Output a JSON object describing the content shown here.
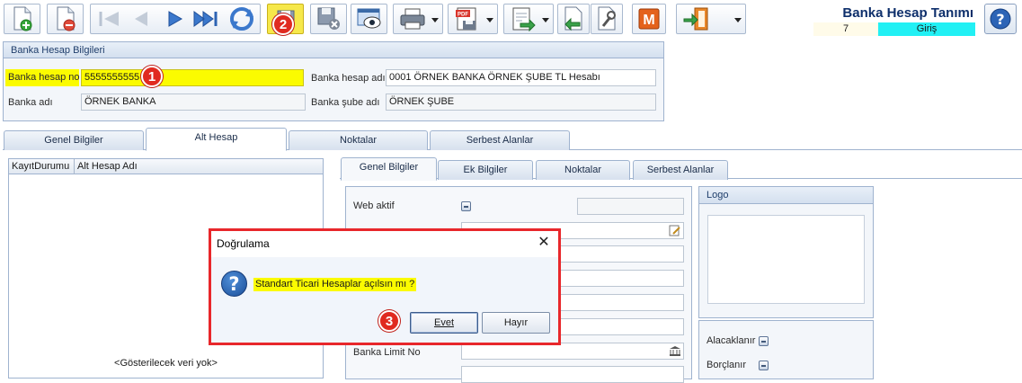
{
  "window": {
    "title": "Banka Hesap Tanımı",
    "record_no": "7",
    "record_mode": "Giriş"
  },
  "toolbar": {
    "buttons": [
      "new-record",
      "delete",
      "first",
      "previous",
      "next",
      "last",
      "refresh",
      "save-yellow",
      "save-cancel",
      "preview",
      "print",
      "pdf",
      "export",
      "import",
      "tools",
      "m-module",
      "exit"
    ]
  },
  "callouts": {
    "one": "1",
    "two": "2",
    "three": "3"
  },
  "account_panel": {
    "title": "Banka Hesap Bilgileri",
    "account_no_label": "Banka hesap no",
    "account_no_value": "5555555555",
    "account_name_label": "Banka hesap adı",
    "account_name_value": "0001 ÖRNEK BANKA ÖRNEK ŞUBE TL Hesabı",
    "bank_name_label": "Banka adı",
    "bank_name_value": "ÖRNEK BANKA",
    "branch_name_label": "Banka şube adı",
    "branch_name_value": "ÖRNEK ŞUBE"
  },
  "main_tabs": [
    "Genel Bilgiler",
    "Alt Hesap",
    "Noktalar",
    "Serbest Alanlar"
  ],
  "grid": {
    "columns": [
      "KayıtDurumu",
      "Alt Hesap Adı"
    ],
    "empty_text": "<Gösterilecek veri yok>"
  },
  "sub_tabs": [
    "Genel Bilgiler",
    "Ek Bilgiler",
    "Noktalar",
    "Serbest Alanlar"
  ],
  "form": {
    "web_active_label": "Web aktif",
    "limit_no_label": "Banka Limit No",
    "logo_title": "Logo",
    "receivables_label": "Alacaklanır",
    "debits_label": "Borçlanır"
  },
  "dialog": {
    "title": "Doğrulama",
    "close_glyph": "✕",
    "icon_glyph": "?",
    "message": "Standart Ticari Hesaplar açılsın mı ?",
    "yes_label": "Evet",
    "no_label": "Hayır"
  },
  "colors": {
    "highlight": "#fbfb00",
    "mode_bg": "#22f0f4",
    "callout_red": "#e02a20",
    "title_blue": "#0e2f6b"
  }
}
